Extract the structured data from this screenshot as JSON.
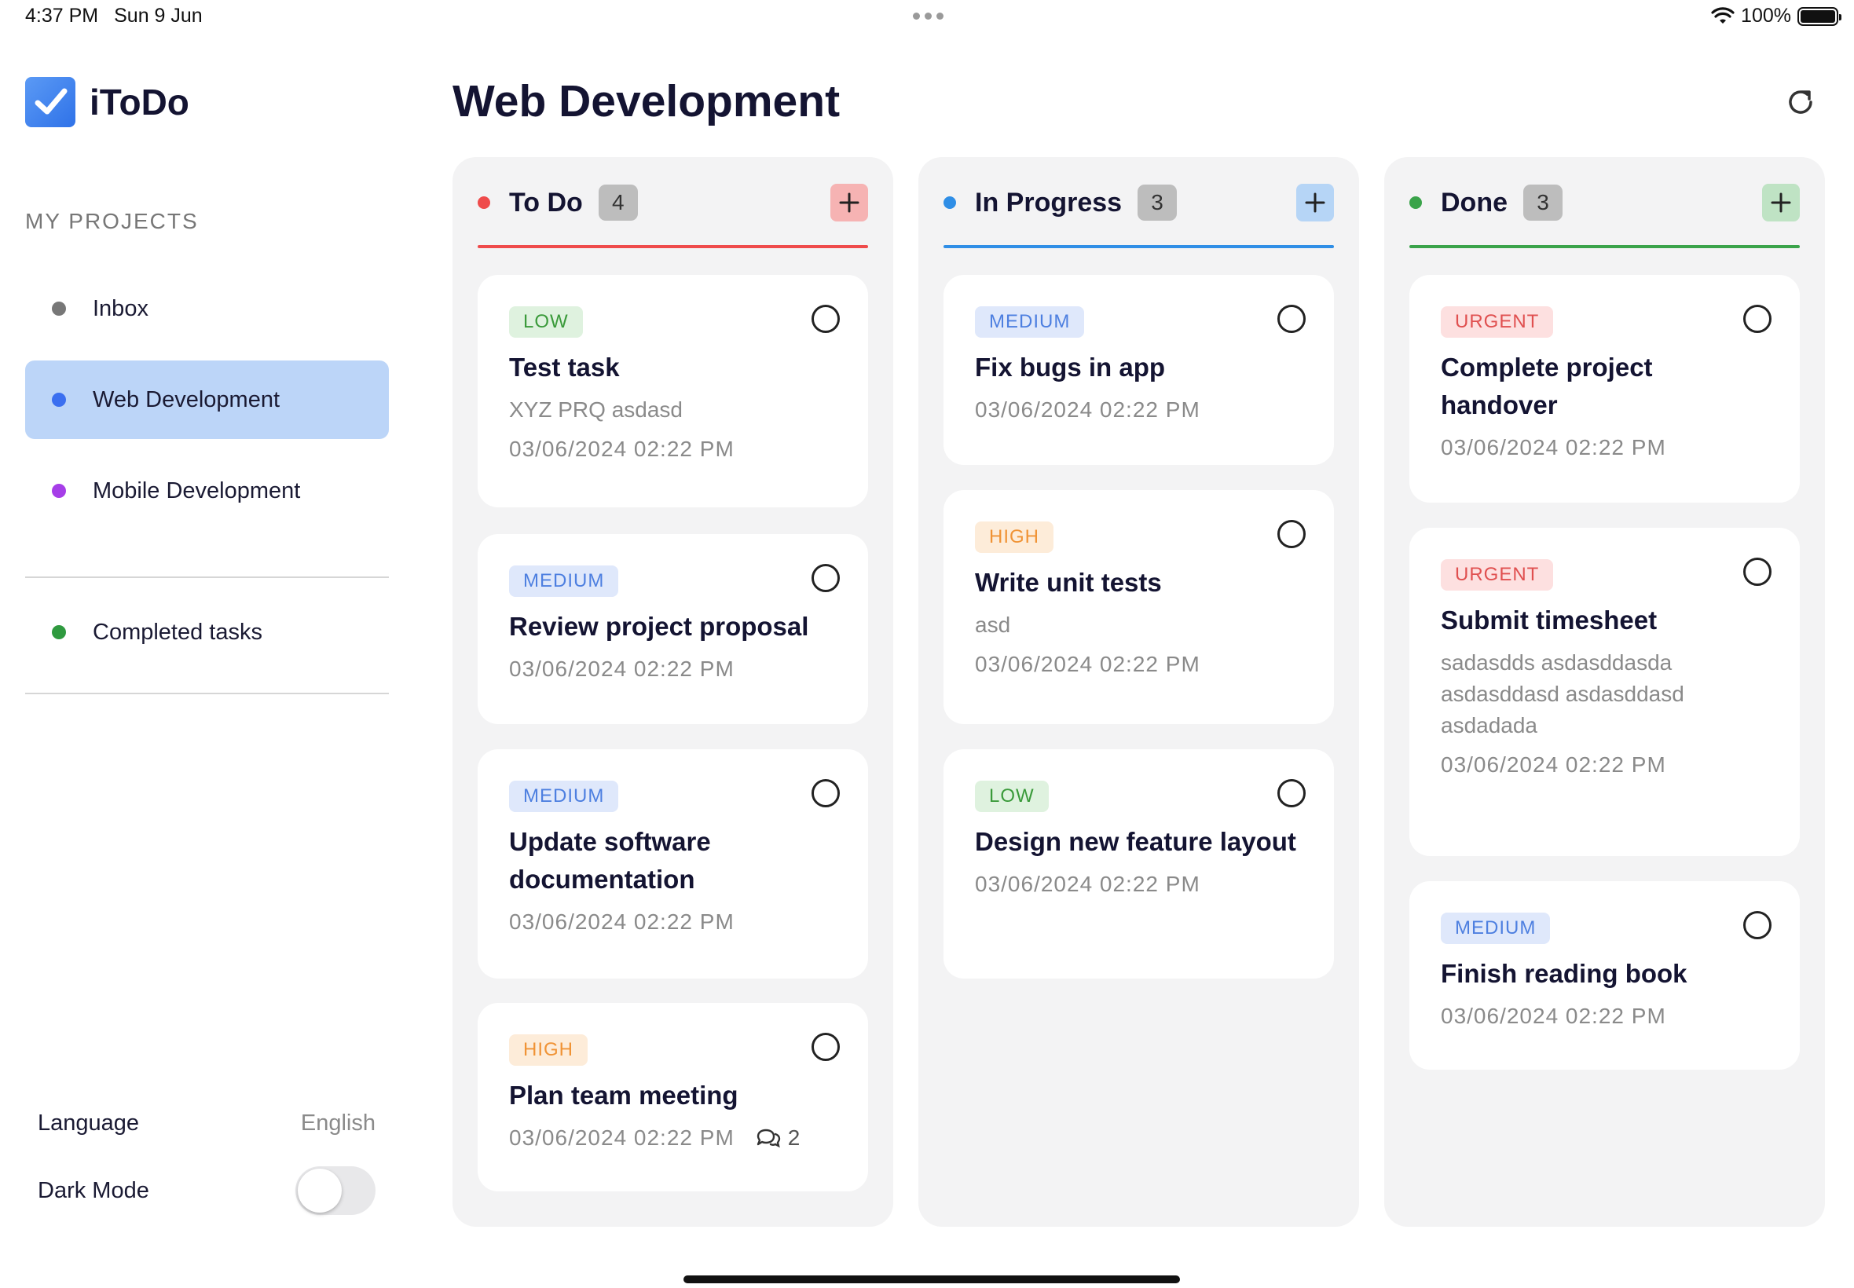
{
  "status_bar": {
    "time": "4:37 PM",
    "date": "Sun 9 Jun",
    "battery": "100%",
    "battery_level": 1.0
  },
  "app": {
    "name": "iToDo"
  },
  "sidebar": {
    "heading": "MY PROJECTS",
    "items": [
      {
        "label": "Inbox",
        "color": "#777777",
        "active": false
      },
      {
        "label": "Web Development",
        "color": "#3b6ff0",
        "active": true
      },
      {
        "label": "Mobile Development",
        "color": "#a63ee8",
        "active": false
      }
    ],
    "completed": {
      "label": "Completed tasks",
      "color": "#2f9a3f"
    },
    "settings": {
      "language_label": "Language",
      "language_value": "English",
      "dark_mode_label": "Dark Mode",
      "dark_mode_on": false
    }
  },
  "page": {
    "title": "Web Development"
  },
  "columns": [
    {
      "title": "To Do",
      "count": "4",
      "color": "#ef4b4b",
      "add_bg": "#f6b3b3",
      "cards": [
        {
          "priority": "LOW",
          "title": "Test task",
          "description": "XYZ PRQ asdasd",
          "date": "03/06/2024 02:22 PM"
        },
        {
          "priority": "MEDIUM",
          "title": "Review project proposal",
          "date": "03/06/2024 02:22 PM"
        },
        {
          "priority": "MEDIUM",
          "title": "Update software documentation",
          "date": "03/06/2024 02:22 PM"
        },
        {
          "priority": "HIGH",
          "title": "Plan team meeting",
          "date": "03/06/2024 02:22 PM",
          "comments": "2"
        }
      ]
    },
    {
      "title": "In Progress",
      "count": "3",
      "color": "#2f8ee6",
      "add_bg": "#b6d5f6",
      "cards": [
        {
          "priority": "MEDIUM",
          "title": "Fix bugs in app",
          "date": "03/06/2024 02:22 PM"
        },
        {
          "priority": "HIGH",
          "title": "Write unit tests",
          "description": "asd",
          "date": "03/06/2024 02:22 PM"
        },
        {
          "priority": "LOW",
          "title": "Design new feature layout",
          "date": "03/06/2024 02:22 PM"
        }
      ]
    },
    {
      "title": "Done",
      "count": "3",
      "color": "#3aa34a",
      "add_bg": "#bfe3c4",
      "cards": [
        {
          "priority": "URGENT",
          "title": "Complete project handover",
          "date": "03/06/2024 02:22 PM"
        },
        {
          "priority": "URGENT",
          "title": "Submit timesheet",
          "description": "sadasdds asdasddasda asdasddasd asdasddasd asdadada",
          "date": "03/06/2024 02:22 PM"
        },
        {
          "priority": "MEDIUM",
          "title": "Finish reading book",
          "date": "03/06/2024 02:22 PM"
        }
      ]
    }
  ]
}
